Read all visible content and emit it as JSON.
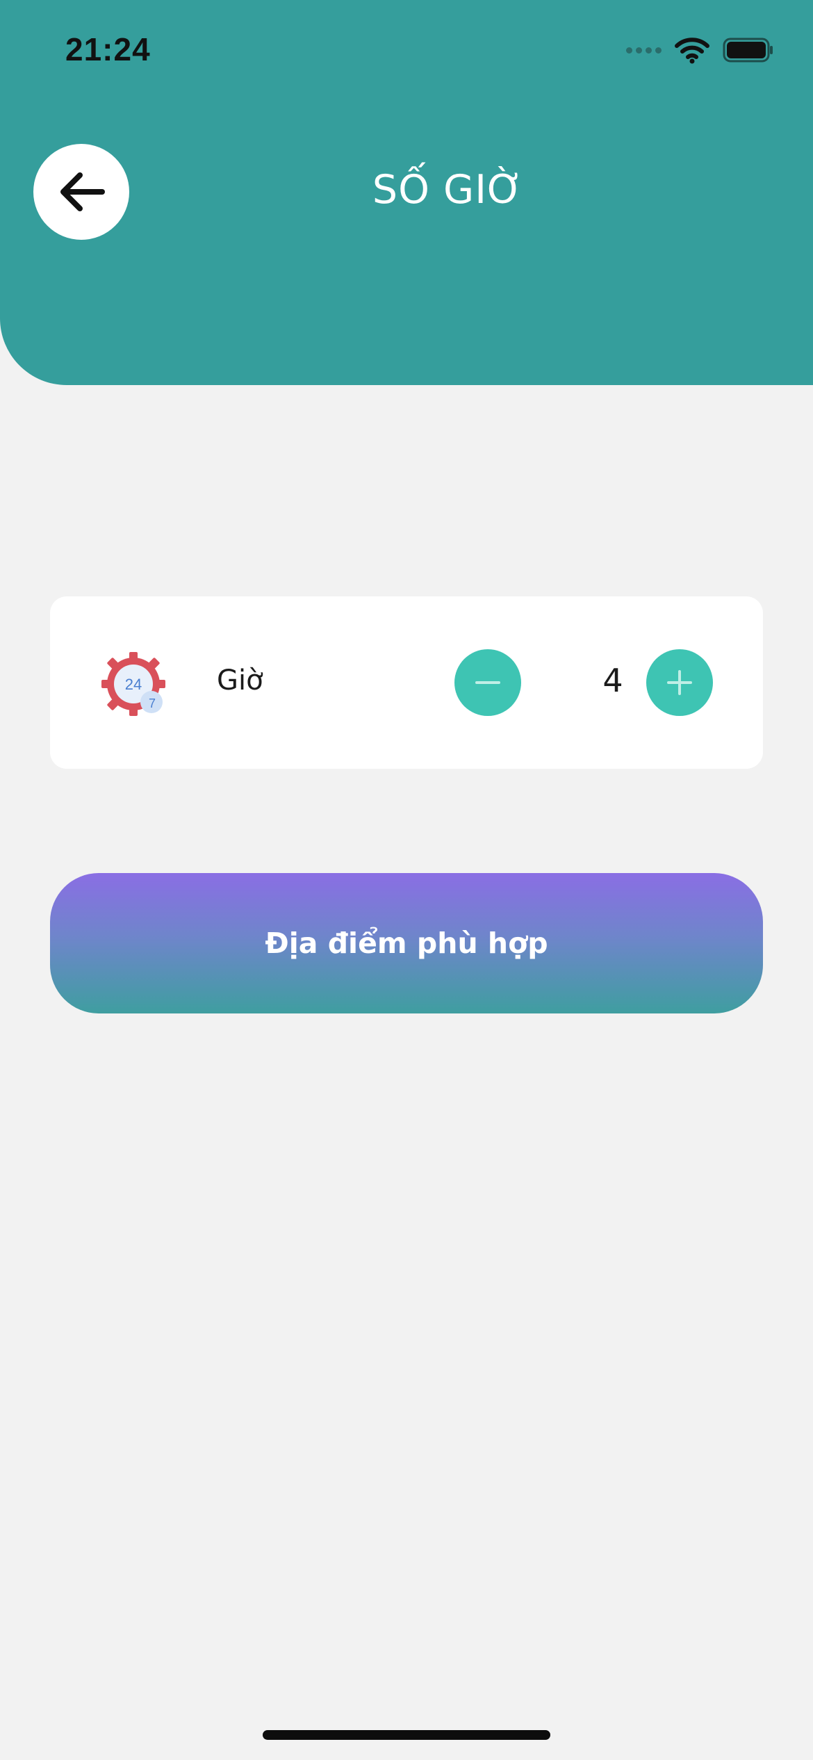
{
  "status_bar": {
    "time": "21:24",
    "icons": [
      "cellular-signal-icon",
      "wifi-icon",
      "battery-icon"
    ]
  },
  "header": {
    "title": "SỐ GIỜ",
    "back_icon": "arrow-left-icon",
    "background_color": "#359e9c"
  },
  "hours_card": {
    "icon": "clock-24-7-icon",
    "label": "Giờ",
    "value": "4",
    "minus_icon": "minus-icon",
    "plus_icon": "plus-icon",
    "button_color": "#3ec4b3"
  },
  "submit": {
    "label": "Địa điểm phù hợp",
    "gradient": [
      "#8a6ee4",
      "#3f9ea0"
    ]
  },
  "colors": {
    "background": "#f2f2f2",
    "accent": "#359e9c"
  }
}
